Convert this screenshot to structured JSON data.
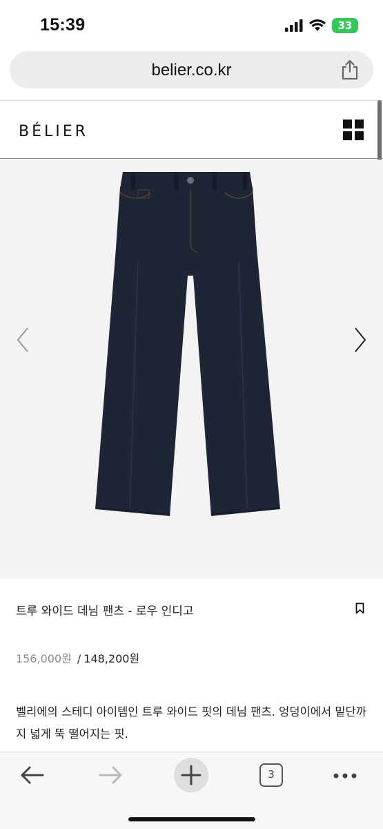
{
  "status_bar": {
    "time": "15:39",
    "battery": "33",
    "icons": [
      "signal-icon",
      "wifi-icon",
      "battery-icon"
    ]
  },
  "browser": {
    "url": "belier.co.kr",
    "open_tabs_count": "3",
    "toolbar_icons": [
      "back-arrow-icon",
      "forward-arrow-icon",
      "plus-icon",
      "tabs-icon",
      "more-icon"
    ]
  },
  "site": {
    "logo": "BÉLIER",
    "menu_icon": "grid-menu-icon"
  },
  "product": {
    "title": "트루 와이드 데님 팬츠 - 로우 인디고",
    "price_original": "156,000원",
    "price_separator": "/",
    "price_sale": "148,200원",
    "description": "벨리에의 스테디 아이템인 트루 와이드 핏의 데님 팬츠. 엉덩이에서 밑단까지 넓게 뚝 떨어지는 핏.",
    "image_icon": "denim-pants-image",
    "denim_color": "#1e2535"
  },
  "colors": {
    "gallery_bg": "#f3f3f4",
    "battery_green": "#34c759"
  }
}
